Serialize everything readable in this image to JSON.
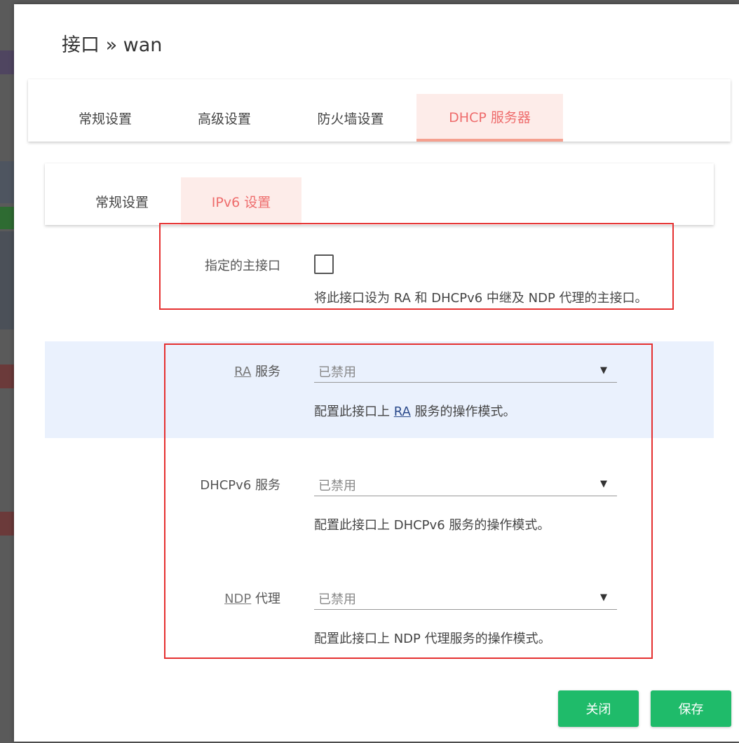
{
  "modal": {
    "title": "接口 » wan"
  },
  "main_tabs": [
    {
      "label": "常规设置"
    },
    {
      "label": "高级设置"
    },
    {
      "label": "防火墙设置"
    },
    {
      "label": "DHCP 服务器"
    }
  ],
  "sub_tabs": [
    {
      "label": "常规设置"
    },
    {
      "label": "IPv6 设置"
    }
  ],
  "master_interface": {
    "label": "指定的主接口",
    "checked": false,
    "description": "将此接口设为 RA 和 DHCPv6 中继及 NDP 代理的主接口。"
  },
  "ra_service": {
    "label_abbr": "RA",
    "label_rest": " 服务",
    "value": "已禁用",
    "desc_prefix": "配置此接口上 ",
    "desc_abbr": "RA",
    "desc_suffix": " 服务的操作模式。"
  },
  "dhcpv6_service": {
    "label": "DHCPv6 服务",
    "value": "已禁用",
    "description": "配置此接口上 DHCPv6 服务的操作模式。"
  },
  "ndp_proxy": {
    "label_abbr": "NDP",
    "label_rest": " 代理",
    "value": "已禁用",
    "description": "配置此接口上 NDP 代理服务的操作模式。"
  },
  "buttons": {
    "close": "关闭",
    "save": "保存"
  },
  "icons": {
    "dropdown": "caret-down-icon"
  },
  "colors": {
    "active_tab_text": "#ee6c6c",
    "active_tab_bg": "#fdece9",
    "button_green": "#1fbb6a",
    "highlight_red": "#e53030",
    "focus_band": "#eaf1fd"
  }
}
